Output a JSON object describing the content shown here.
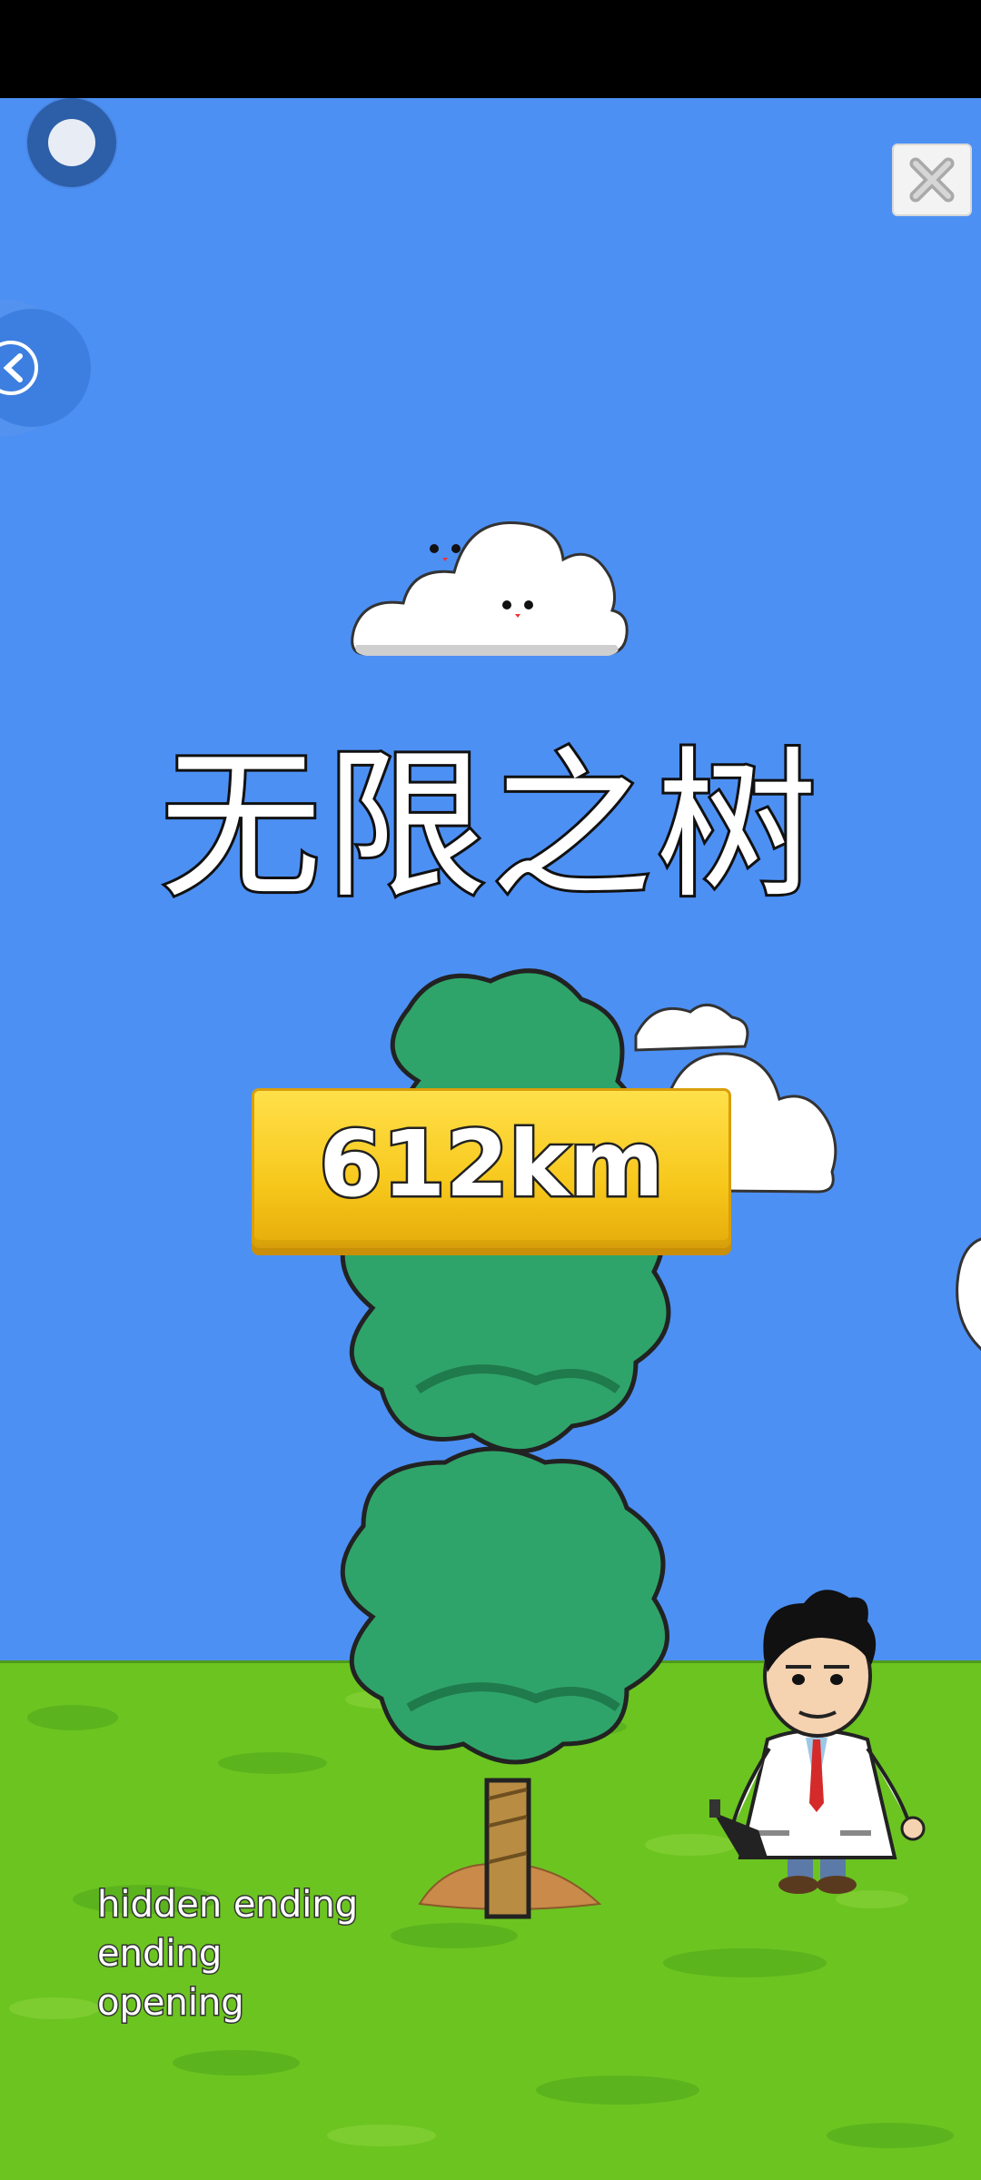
{
  "game": {
    "title": "无限之树",
    "distance": "612km",
    "endings": [
      "hidden ending",
      "ending",
      "opening"
    ]
  },
  "controls": {
    "record_icon": "record-icon",
    "close_icon": "close-icon",
    "side_tab_icon": "back-icon"
  },
  "colors": {
    "sky": "#4d90f4",
    "ground": "#6cc421",
    "sign": "#f7c81c",
    "foliage": "#2fa46a"
  }
}
